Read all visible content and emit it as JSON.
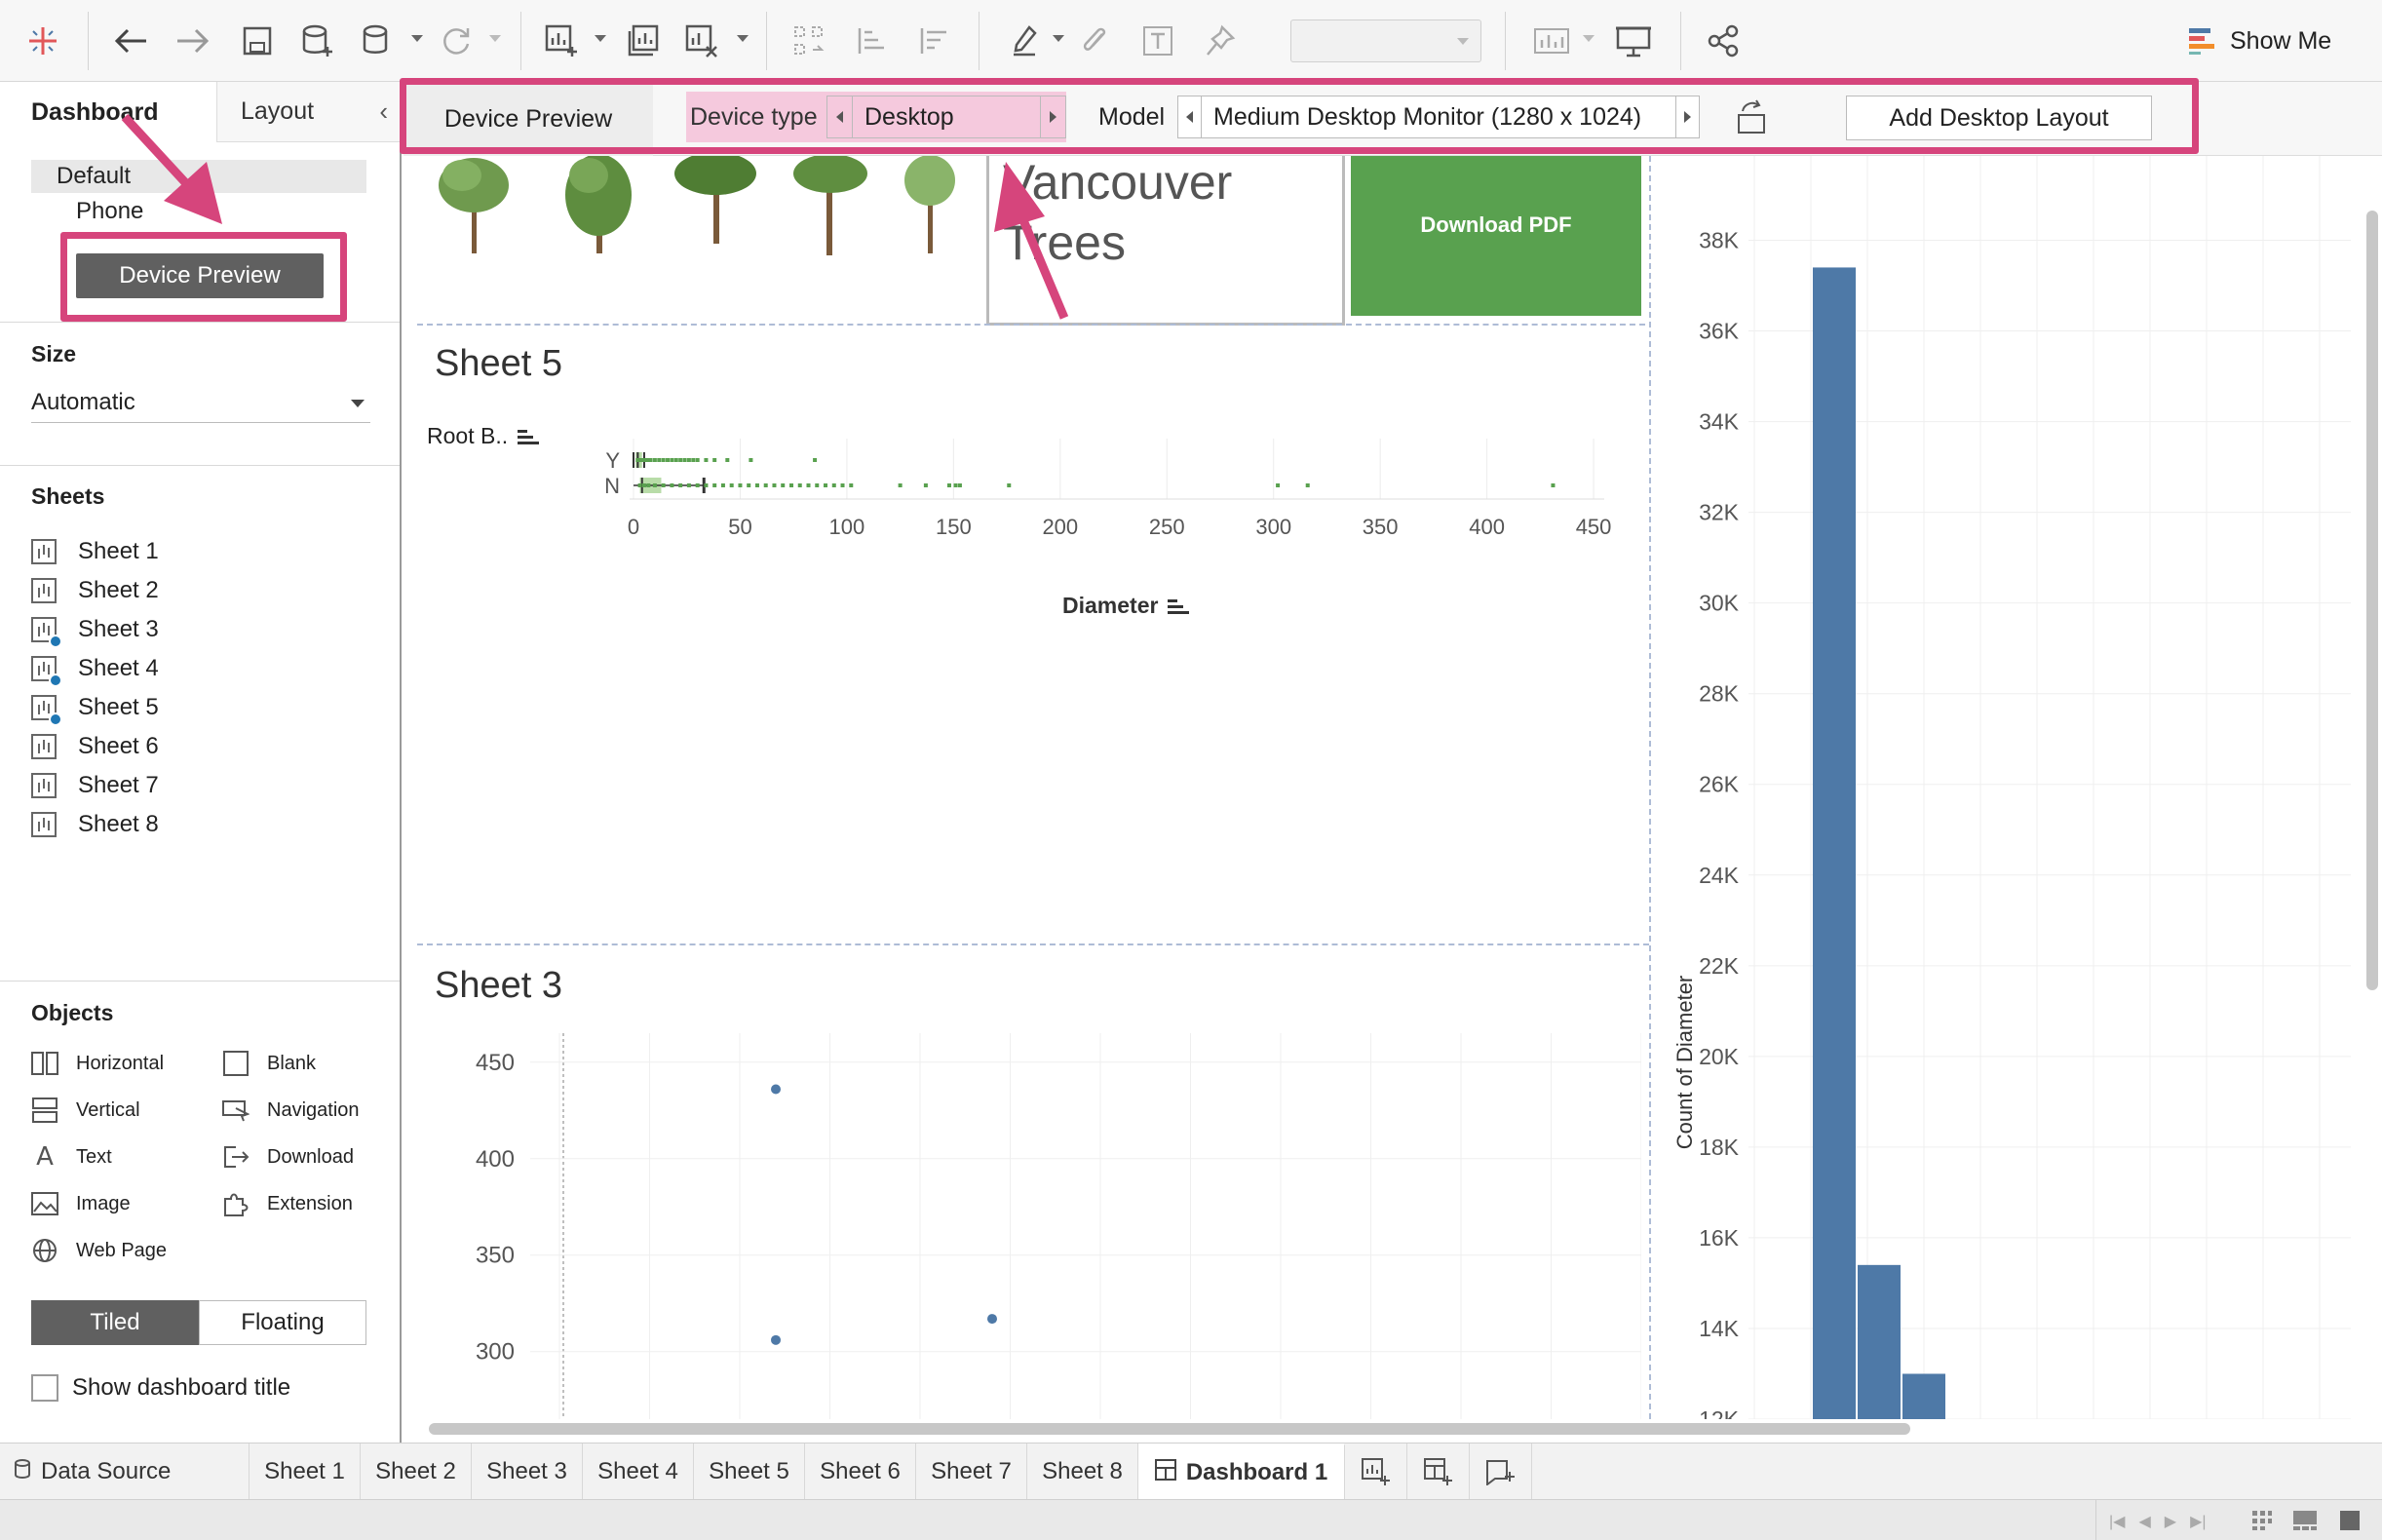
{
  "toolbar": {
    "show_me_label": "Show Me",
    "icons": [
      "tableau-logo-icon",
      "undo-icon",
      "redo-icon",
      "save-icon",
      "new-datasource-icon",
      "pause-updates-icon",
      "refresh-icon",
      "new-worksheet-icon",
      "duplicate-sheet-icon",
      "clear-sheet-icon",
      "swap-icon",
      "sort-ascending-icon",
      "sort-descending-icon",
      "highlight-icon",
      "group-icon",
      "labels-icon",
      "pin-icon",
      "fit-icon",
      "presentation-icon",
      "share-icon"
    ]
  },
  "left_pane": {
    "tabs": [
      "Dashboard",
      "Layout"
    ],
    "layouts": {
      "default": "Default",
      "phone": "Phone"
    },
    "device_preview_button": "Device Preview",
    "size": {
      "title": "Size",
      "value": "Automatic"
    },
    "sheets_title": "Sheets",
    "sheets": [
      "Sheet 1",
      "Sheet 2",
      "Sheet 3",
      "Sheet 4",
      "Sheet 5",
      "Sheet 6",
      "Sheet 7",
      "Sheet 8"
    ],
    "objects_title": "Objects",
    "objects": [
      {
        "label": "Horizontal",
        "icon": "horizontal-icon"
      },
      {
        "label": "Blank",
        "icon": "blank-icon"
      },
      {
        "label": "Vertical",
        "icon": "vertical-icon"
      },
      {
        "label": "Navigation",
        "icon": "navigation-icon"
      },
      {
        "label": "Text",
        "icon": "text-icon"
      },
      {
        "label": "Download",
        "icon": "download-icon"
      },
      {
        "label": "Image",
        "icon": "image-icon"
      },
      {
        "label": "Extension",
        "icon": "extension-icon"
      },
      {
        "label": "Web Page",
        "icon": "web-page-icon"
      }
    ],
    "tiled_label": "Tiled",
    "floating_label": "Floating",
    "show_title_label": "Show dashboard title"
  },
  "device_bar": {
    "tab_label": "Device Preview",
    "device_type_label": "Device type",
    "device_type_value": "Desktop",
    "model_label": "Model",
    "model_value": "Medium Desktop Monitor (1280 x 1024)",
    "add_layout_button": "Add Desktop Layout"
  },
  "dashboard": {
    "title_text_line1": "Vancouver",
    "title_text_line2": "Trees",
    "download_button": "Download PDF",
    "sheet5_title": "Sheet 5",
    "sheet3_title": "Sheet 3"
  },
  "chart_data": [
    {
      "type": "box",
      "title": "Sheet 5",
      "ylabel": "Root B..",
      "xlabel": "Diameter",
      "categories": [
        "Y",
        "N"
      ],
      "x_ticks": [
        "0",
        "50",
        "100",
        "150",
        "200",
        "250",
        "300",
        "350",
        "400",
        "450"
      ],
      "xlim": [
        0,
        455
      ],
      "outliers": {
        "Y": [
          2,
          3,
          4,
          5,
          6,
          7,
          8,
          10,
          12,
          14,
          16,
          18,
          20,
          22,
          24,
          26,
          28,
          30,
          34,
          38,
          44,
          55,
          85
        ],
        "N": [
          3,
          5,
          7,
          10,
          14,
          18,
          22,
          26,
          30,
          34,
          38,
          42,
          46,
          50,
          54,
          58,
          62,
          66,
          70,
          74,
          78,
          82,
          86,
          90,
          94,
          98,
          102,
          125,
          137,
          148,
          151,
          153,
          176,
          302,
          316,
          431
        ]
      },
      "box": {
        "N": {
          "q1": 3,
          "median": 4,
          "q3": 13,
          "whisker_low": 0,
          "whisker_high": 33
        }
      }
    },
    {
      "type": "scatter",
      "title": "Sheet 3",
      "y_ticks": [
        "450",
        "400",
        "350",
        "300"
      ],
      "ylim": [
        265,
        460
      ],
      "points": [
        {
          "x": 1,
          "y": 436
        },
        {
          "x": 1,
          "y": 306
        },
        {
          "x": 2,
          "y": 317
        }
      ],
      "xlim": [
        0,
        5
      ],
      "color": "#4e79a7"
    },
    {
      "type": "bar",
      "ylabel": "Count of Diameter",
      "y_ticks": [
        "38K",
        "36K",
        "34K",
        "32K",
        "30K",
        "28K",
        "26K",
        "24K",
        "22K",
        "20K",
        "18K",
        "16K",
        "14K",
        "12K"
      ],
      "ylim": [
        12000,
        39000
      ],
      "values": [
        37400,
        15400,
        13000
      ],
      "color": "#4e79a7"
    }
  ],
  "bottom_tabs": {
    "data_source": "Data Source",
    "sheets": [
      "Sheet 1",
      "Sheet 2",
      "Sheet 3",
      "Sheet 4",
      "Sheet 5",
      "Sheet 6",
      "Sheet 7",
      "Sheet 8"
    ],
    "active": "Dashboard 1"
  },
  "colors": {
    "annotation": "#d6457c",
    "download_green": "#59a14f",
    "bar_blue": "#4e79a7",
    "device_type_bg": "#f5c9dd"
  }
}
